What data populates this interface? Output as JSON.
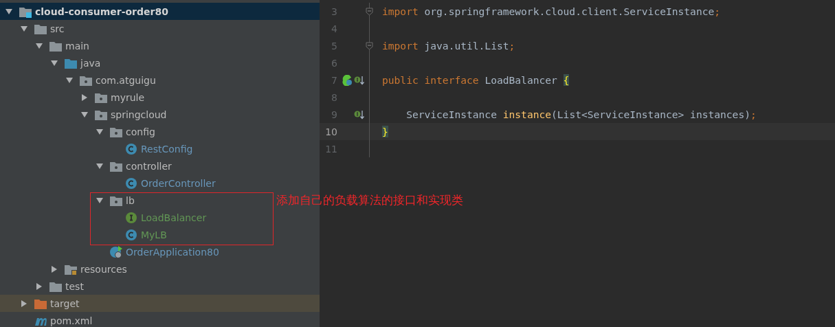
{
  "project_tree": [
    {
      "label": "cloud-consumer-order80",
      "kind": "module",
      "color": "#d4d4d4",
      "expanded": true,
      "selected": true,
      "highlighted": false,
      "children": [
        {
          "label": "src",
          "kind": "folder",
          "color": "#bbbbbb",
          "expanded": true,
          "selected": false,
          "highlighted": false,
          "children": [
            {
              "label": "main",
              "kind": "folder",
              "color": "#bbbbbb",
              "expanded": true,
              "selected": false,
              "highlighted": false,
              "children": [
                {
                  "label": "java",
                  "kind": "source-folder",
                  "color": "#bbbbbb",
                  "expanded": true,
                  "selected": false,
                  "highlighted": false,
                  "children": [
                    {
                      "label": "com.atguigu",
                      "kind": "package",
                      "color": "#bbbbbb",
                      "expanded": true,
                      "selected": false,
                      "highlighted": false,
                      "children": [
                        {
                          "label": "myrule",
                          "kind": "package",
                          "color": "#bbbbbb",
                          "expanded": false,
                          "selected": false,
                          "highlighted": false
                        },
                        {
                          "label": "springcloud",
                          "kind": "package",
                          "color": "#bbbbbb",
                          "expanded": true,
                          "selected": false,
                          "highlighted": false,
                          "children": [
                            {
                              "label": "config",
                              "kind": "package",
                              "color": "#bbbbbb",
                              "expanded": true,
                              "selected": false,
                              "highlighted": false,
                              "children": [
                                {
                                  "label": "RestConfig",
                                  "kind": "class",
                                  "color": "#6897bb",
                                  "selected": false,
                                  "highlighted": false
                                }
                              ]
                            },
                            {
                              "label": "controller",
                              "kind": "package",
                              "color": "#bbbbbb",
                              "expanded": true,
                              "selected": false,
                              "highlighted": false,
                              "children": [
                                {
                                  "label": "OrderController",
                                  "kind": "class",
                                  "color": "#6897bb",
                                  "selected": false,
                                  "highlighted": false
                                }
                              ]
                            },
                            {
                              "label": "lb",
                              "kind": "package",
                              "color": "#bbbbbb",
                              "expanded": true,
                              "selected": false,
                              "highlighted": false,
                              "children": [
                                {
                                  "label": "LoadBalancer",
                                  "kind": "interface",
                                  "color": "#629755",
                                  "selected": false,
                                  "highlighted": false
                                },
                                {
                                  "label": "MyLB",
                                  "kind": "class",
                                  "color": "#629755",
                                  "selected": false,
                                  "highlighted": false
                                }
                              ]
                            },
                            {
                              "label": "OrderApplication80",
                              "kind": "app-class",
                              "color": "#6897bb",
                              "selected": false,
                              "highlighted": false
                            }
                          ]
                        }
                      ]
                    }
                  ]
                },
                {
                  "label": "resources",
                  "kind": "resources-folder",
                  "color": "#bbbbbb",
                  "expanded": false,
                  "selected": false,
                  "highlighted": false
                }
              ]
            },
            {
              "label": "test",
              "kind": "folder",
              "color": "#bbbbbb",
              "expanded": false,
              "selected": false,
              "highlighted": false
            }
          ]
        },
        {
          "label": "target",
          "kind": "target-folder",
          "color": "#bbbbbb",
          "expanded": false,
          "selected": false,
          "highlighted": true
        },
        {
          "label": "pom.xml",
          "kind": "maven",
          "color": "#bbbbbb",
          "selected": false,
          "highlighted": false
        }
      ]
    }
  ],
  "annotation": {
    "text": "添加自己的负载算法的接口和实现类"
  },
  "editor": {
    "lines": [
      {
        "number": "3",
        "current": false,
        "fold": true,
        "tokens": [
          {
            "kind": "keyword",
            "text": "import"
          },
          {
            "kind": "plain",
            "text": " org.springframework.cloud.client.ServiceInstance"
          },
          {
            "kind": "punct",
            "text": ";"
          }
        ]
      },
      {
        "number": "4",
        "current": false,
        "fold": false
      },
      {
        "number": "5",
        "current": false,
        "fold": true,
        "tokens": [
          {
            "kind": "keyword",
            "text": "import"
          },
          {
            "kind": "plain",
            "text": " java.util.List"
          },
          {
            "kind": "punct",
            "text": ";"
          }
        ]
      },
      {
        "number": "6",
        "current": false,
        "fold": false
      },
      {
        "number": "7",
        "current": false,
        "fold": false,
        "gutter": [
          {
            "kind": "implemented"
          },
          {
            "kind": "interface-down"
          }
        ],
        "tokens": [
          {
            "kind": "keyword",
            "text": "public interface"
          },
          {
            "kind": "plain",
            "text": " LoadBalancer "
          },
          {
            "kind": "brace",
            "text": "{"
          }
        ]
      },
      {
        "number": "8",
        "current": false,
        "fold": false
      },
      {
        "number": "9",
        "current": false,
        "fold": false,
        "gutter": [
          {
            "kind": "interface-down"
          }
        ],
        "tokens": [
          {
            "kind": "plain",
            "text": "    ServiceInstance "
          },
          {
            "kind": "method",
            "text": "instance"
          },
          {
            "kind": "plain",
            "text": "(List<ServiceInstance> instances)"
          },
          {
            "kind": "punct",
            "text": ";"
          }
        ]
      },
      {
        "number": "10",
        "current": true,
        "fold": false,
        "tokens": [
          {
            "kind": "brace",
            "text": "}"
          }
        ]
      },
      {
        "number": "11",
        "current": false,
        "fold": false
      }
    ]
  }
}
